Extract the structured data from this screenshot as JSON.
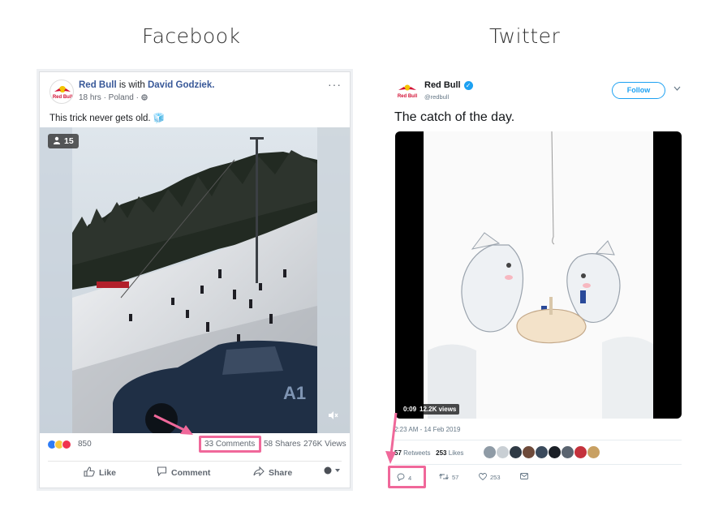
{
  "headings": {
    "facebook": "Facebook",
    "twitter": "Twitter"
  },
  "facebook": {
    "page_name": "Red Bull",
    "with_text": " is with ",
    "tagged": "David Godziek.",
    "meta": "18 hrs · Poland · ",
    "post_text": "This trick never gets old. 🧊",
    "viewer_count": "15",
    "reactions_count": "850",
    "comments": "33 Comments",
    "shares": "58 Shares",
    "views": "276K Views",
    "actions": {
      "like": "Like",
      "comment": "Comment",
      "share": "Share"
    },
    "car_text": "A1",
    "more": "···"
  },
  "twitter": {
    "name": "Red Bull",
    "handle": "@redbull",
    "follow": "Follow",
    "text": "The catch of the day.",
    "duration": "0:09",
    "views": "12.2K views",
    "timestamp": "2:23 AM - 14 Feb 2019",
    "retweets_num": "57",
    "retweets_label": " Retweets",
    "likes_num": "253",
    "likes_label": " Likes",
    "reply_count": "4",
    "rt_count": "57",
    "like_count": "253"
  },
  "logo_text": "Red Bull",
  "colors": {
    "highlight": "#f0689a",
    "fb_link": "#385898",
    "tw_blue": "#1da1f2"
  },
  "icons": [
    "ellipsis-icon",
    "globe-icon",
    "person-icon",
    "mute-icon",
    "thumbs-up-icon",
    "comment-icon",
    "share-icon",
    "verified-icon",
    "reply-icon",
    "retweet-icon",
    "heart-icon",
    "message-icon"
  ]
}
